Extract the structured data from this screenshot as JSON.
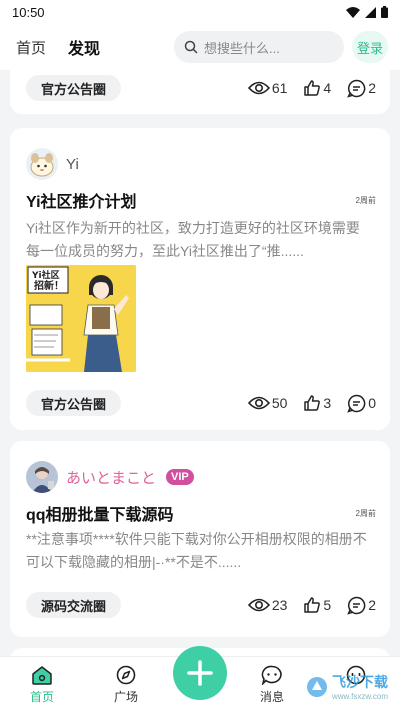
{
  "status": {
    "time": "10:50"
  },
  "header": {
    "tabs": [
      {
        "label": "首页"
      },
      {
        "label": "发现"
      }
    ],
    "search_placeholder": "想搜些什么...",
    "login_label": "登录"
  },
  "feed": [
    {
      "category": "官方公告圈",
      "views": "61",
      "likes": "4",
      "comments": "2"
    },
    {
      "author": "Yi",
      "title": "Yi社区推介计划",
      "time": "2周前",
      "body": "Yi社区作为新开的社区，致力打造更好的社区环境需要每一位成员的努力，至此Yi社区推出了“推......",
      "image_text": [
        "Yi社区",
        "招新！"
      ],
      "category": "官方公告圈",
      "views": "50",
      "likes": "3",
      "comments": "0"
    },
    {
      "author": "あいとまこと",
      "badge": "VIP",
      "title": "qq相册批量下载源码",
      "time": "2周前",
      "body": "**注意事项****软件只能下载对你公开相册权限的相册不可以下载隐藏的相册|-·**不是不......",
      "category": "源码交流圈",
      "views": "23",
      "likes": "5",
      "comments": "2"
    }
  ],
  "bottom_nav": {
    "items": [
      {
        "label": "首页"
      },
      {
        "label": "广场"
      },
      {
        "label": "消息"
      }
    ]
  },
  "watermark": {
    "title": "飞沙下载",
    "subtitle": "www.fsxzw.com"
  },
  "colors": {
    "accent": "#3ecfa6",
    "vip": "#d24fa0",
    "author_pink": "#e0609a"
  }
}
